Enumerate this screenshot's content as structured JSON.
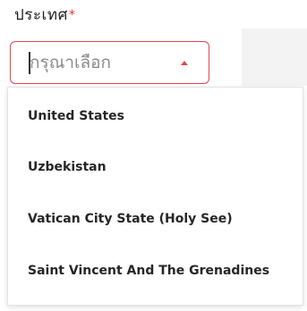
{
  "field": {
    "label": "ประเทศ",
    "required_mark": "*",
    "placeholder": "กรุณาเลือก"
  },
  "dropdown": {
    "options": [
      {
        "label": "United States"
      },
      {
        "label": "Uzbekistan"
      },
      {
        "label": "Vatican City State (Holy See)"
      },
      {
        "label": "Saint Vincent And The Grenadines"
      }
    ]
  },
  "icons": {
    "dropdown_arrow": "caret-up-icon"
  },
  "colors": {
    "accent": "#e0474f",
    "required": "#e02f39",
    "placeholder": "#8a8a8a",
    "text": "#262626"
  }
}
